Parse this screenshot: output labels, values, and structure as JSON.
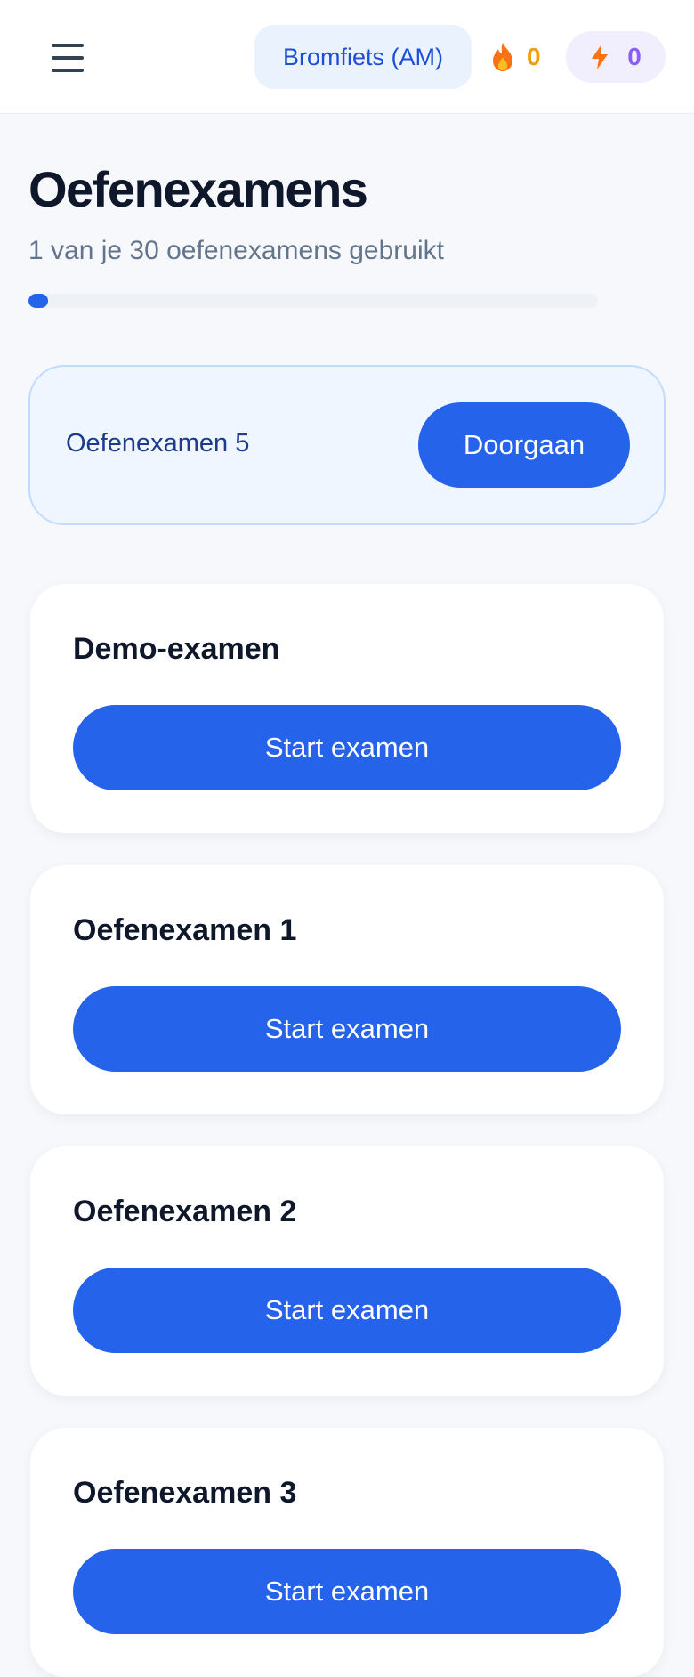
{
  "header": {
    "license_label": "Bromfiets (AM)",
    "streak_count": "0",
    "xp_count": "0",
    "colors": {
      "streak": "#f59e0b",
      "xp": "#8b5cf6",
      "accent": "#2563eb"
    },
    "icons": {
      "menu": "menu-icon",
      "streak": "flame-icon",
      "xp": "lightning-icon"
    }
  },
  "page": {
    "title": "Oefenexamens",
    "usage_text": "1 van je 30 oefenexamens gebruikt",
    "usage_used": 1,
    "usage_total": 30
  },
  "resume": {
    "exam_name": "Oefenexamen 5",
    "button_label": "Doorgaan"
  },
  "exams": [
    {
      "title": "Demo-examen",
      "button_label": "Start examen"
    },
    {
      "title": "Oefenexamen 1",
      "button_label": "Start examen"
    },
    {
      "title": "Oefenexamen 2",
      "button_label": "Start examen"
    },
    {
      "title": "Oefenexamen 3",
      "button_label": "Start examen"
    }
  ]
}
